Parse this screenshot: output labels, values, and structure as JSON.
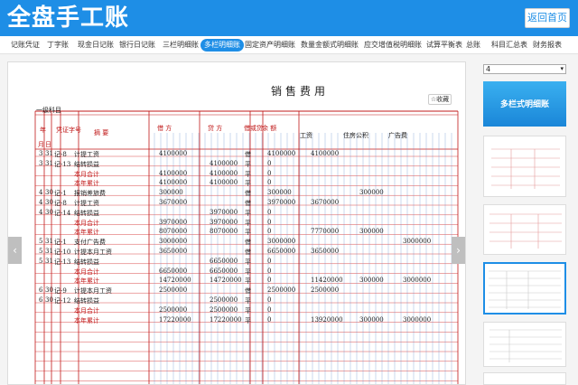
{
  "app": {
    "title": "全盘手工账",
    "home_button": "返回首页"
  },
  "tabs": [
    {
      "label": "记账凭证"
    },
    {
      "label": "丁字账"
    },
    {
      "label": "现金日记账"
    },
    {
      "label": "银行日记账"
    },
    {
      "label": "三栏明细账"
    },
    {
      "label": "多栏明细账",
      "active": true
    },
    {
      "label": "固定资产明细账"
    },
    {
      "label": "数量金额式明细账"
    },
    {
      "label": "应交增值税明细账"
    },
    {
      "label": "试算平衡表"
    },
    {
      "label": "总账"
    },
    {
      "label": "科目汇总表"
    },
    {
      "label": "财务报表"
    }
  ],
  "viewer": {
    "favorite_label": "收藏",
    "prev_arrow": "‹",
    "next_arrow": "›"
  },
  "sidebar": {
    "page_select_value": "4",
    "banner_text": "多栏式明细账"
  },
  "ledger": {
    "title": "销售费用",
    "subject_label": "一级科目",
    "headers": {
      "year": "年",
      "month": "月",
      "day": "日",
      "voucher": "凭证字号",
      "summary": "摘  要",
      "debit": "借  方",
      "credit": "贷  方",
      "direction": "借或贷",
      "balance": "余  额",
      "col_wage": "工资",
      "col_fund": "住房公积",
      "col_ad": "广告费"
    },
    "rows": [
      {
        "m": "3",
        "d": "31",
        "v": "记-8",
        "summary": "计提工资",
        "debit": "4100000",
        "credit": "",
        "dir": "借",
        "bal": "4100000",
        "c1": "4100000",
        "c2": "",
        "c3": "",
        "red": false
      },
      {
        "m": "3",
        "d": "31",
        "v": "记-13",
        "summary": "结转损益",
        "debit": "",
        "credit": "4100000",
        "dir": "平",
        "bal": "0",
        "c1": "",
        "c2": "",
        "c3": "",
        "red": false
      },
      {
        "m": "",
        "d": "",
        "v": "",
        "summary": "本月合计",
        "debit": "4100000",
        "credit": "4100000",
        "dir": "平",
        "bal": "0",
        "c1": "",
        "c2": "",
        "c3": "",
        "red": true
      },
      {
        "m": "",
        "d": "",
        "v": "",
        "summary": "本年累计",
        "debit": "4100000",
        "credit": "4100000",
        "dir": "平",
        "bal": "0",
        "c1": "",
        "c2": "",
        "c3": "",
        "red": true
      },
      {
        "m": "4",
        "d": "30",
        "v": "记-1",
        "summary": "报销差旅费",
        "debit": "300000",
        "credit": "",
        "dir": "借",
        "bal": "300000",
        "c1": "",
        "c2": "300000",
        "c3": "",
        "red": false
      },
      {
        "m": "4",
        "d": "30",
        "v": "记-8",
        "summary": "计提工资",
        "debit": "3670000",
        "credit": "",
        "dir": "借",
        "bal": "3970000",
        "c1": "3670000",
        "c2": "",
        "c3": "",
        "red": false
      },
      {
        "m": "4",
        "d": "30",
        "v": "记-14",
        "summary": "结转损益",
        "debit": "",
        "credit": "3970000",
        "dir": "平",
        "bal": "0",
        "c1": "",
        "c2": "",
        "c3": "",
        "red": false
      },
      {
        "m": "",
        "d": "",
        "v": "",
        "summary": "本月合计",
        "debit": "3970000",
        "credit": "3970000",
        "dir": "平",
        "bal": "0",
        "c1": "",
        "c2": "",
        "c3": "",
        "red": true
      },
      {
        "m": "",
        "d": "",
        "v": "",
        "summary": "本年累计",
        "debit": "8070000",
        "credit": "8070000",
        "dir": "平",
        "bal": "0",
        "c1": "7770000",
        "c2": "300000",
        "c3": "",
        "red": true
      },
      {
        "m": "5",
        "d": "31",
        "v": "记-1",
        "summary": "支付广告费",
        "debit": "3000000",
        "credit": "",
        "dir": "借",
        "bal": "3000000",
        "c1": "",
        "c2": "",
        "c3": "3000000",
        "red": false
      },
      {
        "m": "5",
        "d": "31",
        "v": "记-10",
        "summary": "计提本月工资",
        "debit": "3650000",
        "credit": "",
        "dir": "借",
        "bal": "6650000",
        "c1": "3650000",
        "c2": "",
        "c3": "",
        "red": false
      },
      {
        "m": "5",
        "d": "31",
        "v": "记-13",
        "summary": "结转损益",
        "debit": "",
        "credit": "6650000",
        "dir": "平",
        "bal": "0",
        "c1": "",
        "c2": "",
        "c3": "",
        "red": false
      },
      {
        "m": "",
        "d": "",
        "v": "",
        "summary": "本月合计",
        "debit": "6650000",
        "credit": "6650000",
        "dir": "平",
        "bal": "0",
        "c1": "",
        "c2": "",
        "c3": "",
        "red": true
      },
      {
        "m": "",
        "d": "",
        "v": "",
        "summary": "本年累计",
        "debit": "14720000",
        "credit": "14720000",
        "dir": "平",
        "bal": "0",
        "c1": "11420000",
        "c2": "300000",
        "c3": "3000000",
        "red": true
      },
      {
        "m": "6",
        "d": "30",
        "v": "记-9",
        "summary": "计提本月工资",
        "debit": "2500000",
        "credit": "",
        "dir": "借",
        "bal": "2500000",
        "c1": "2500000",
        "c2": "",
        "c3": "",
        "red": false
      },
      {
        "m": "6",
        "d": "30",
        "v": "记-12",
        "summary": "结转损益",
        "debit": "",
        "credit": "2500000",
        "dir": "平",
        "bal": "0",
        "c1": "",
        "c2": "",
        "c3": "",
        "red": false
      },
      {
        "m": "",
        "d": "",
        "v": "",
        "summary": "本月合计",
        "debit": "2500000",
        "credit": "2500000",
        "dir": "平",
        "bal": "0",
        "c1": "",
        "c2": "",
        "c3": "",
        "red": true
      },
      {
        "m": "",
        "d": "",
        "v": "",
        "summary": "本年累计",
        "debit": "17220000",
        "credit": "17220000",
        "dir": "平",
        "bal": "0",
        "c1": "13920000",
        "c2": "300000",
        "c3": "3000000",
        "red": true
      }
    ]
  }
}
